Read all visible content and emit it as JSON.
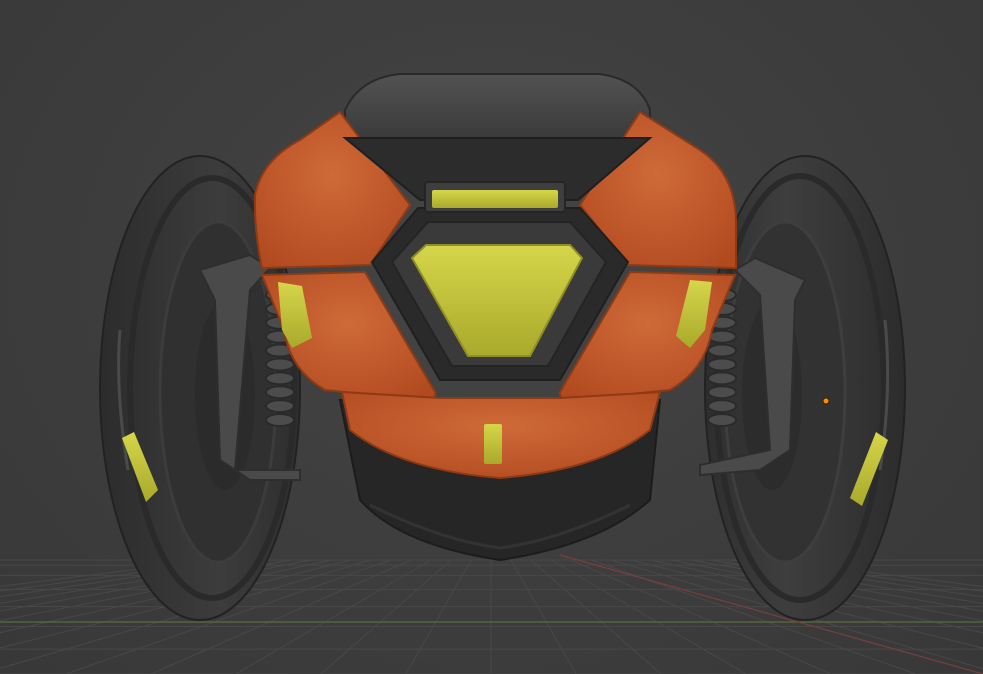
{
  "viewport": {
    "background_color": "#3d3d3d",
    "grid_color": "#484848",
    "x_axis_color": "#7a3e3e",
    "y_axis_color": "#5a6e3a",
    "origin_marker_color": "#ff8c00"
  },
  "model": {
    "body_color": "#454545",
    "dark_color": "#262626",
    "shell_color": "#c45a2c",
    "accent_color": "#c8c83c",
    "wheel_color": "#353535"
  }
}
